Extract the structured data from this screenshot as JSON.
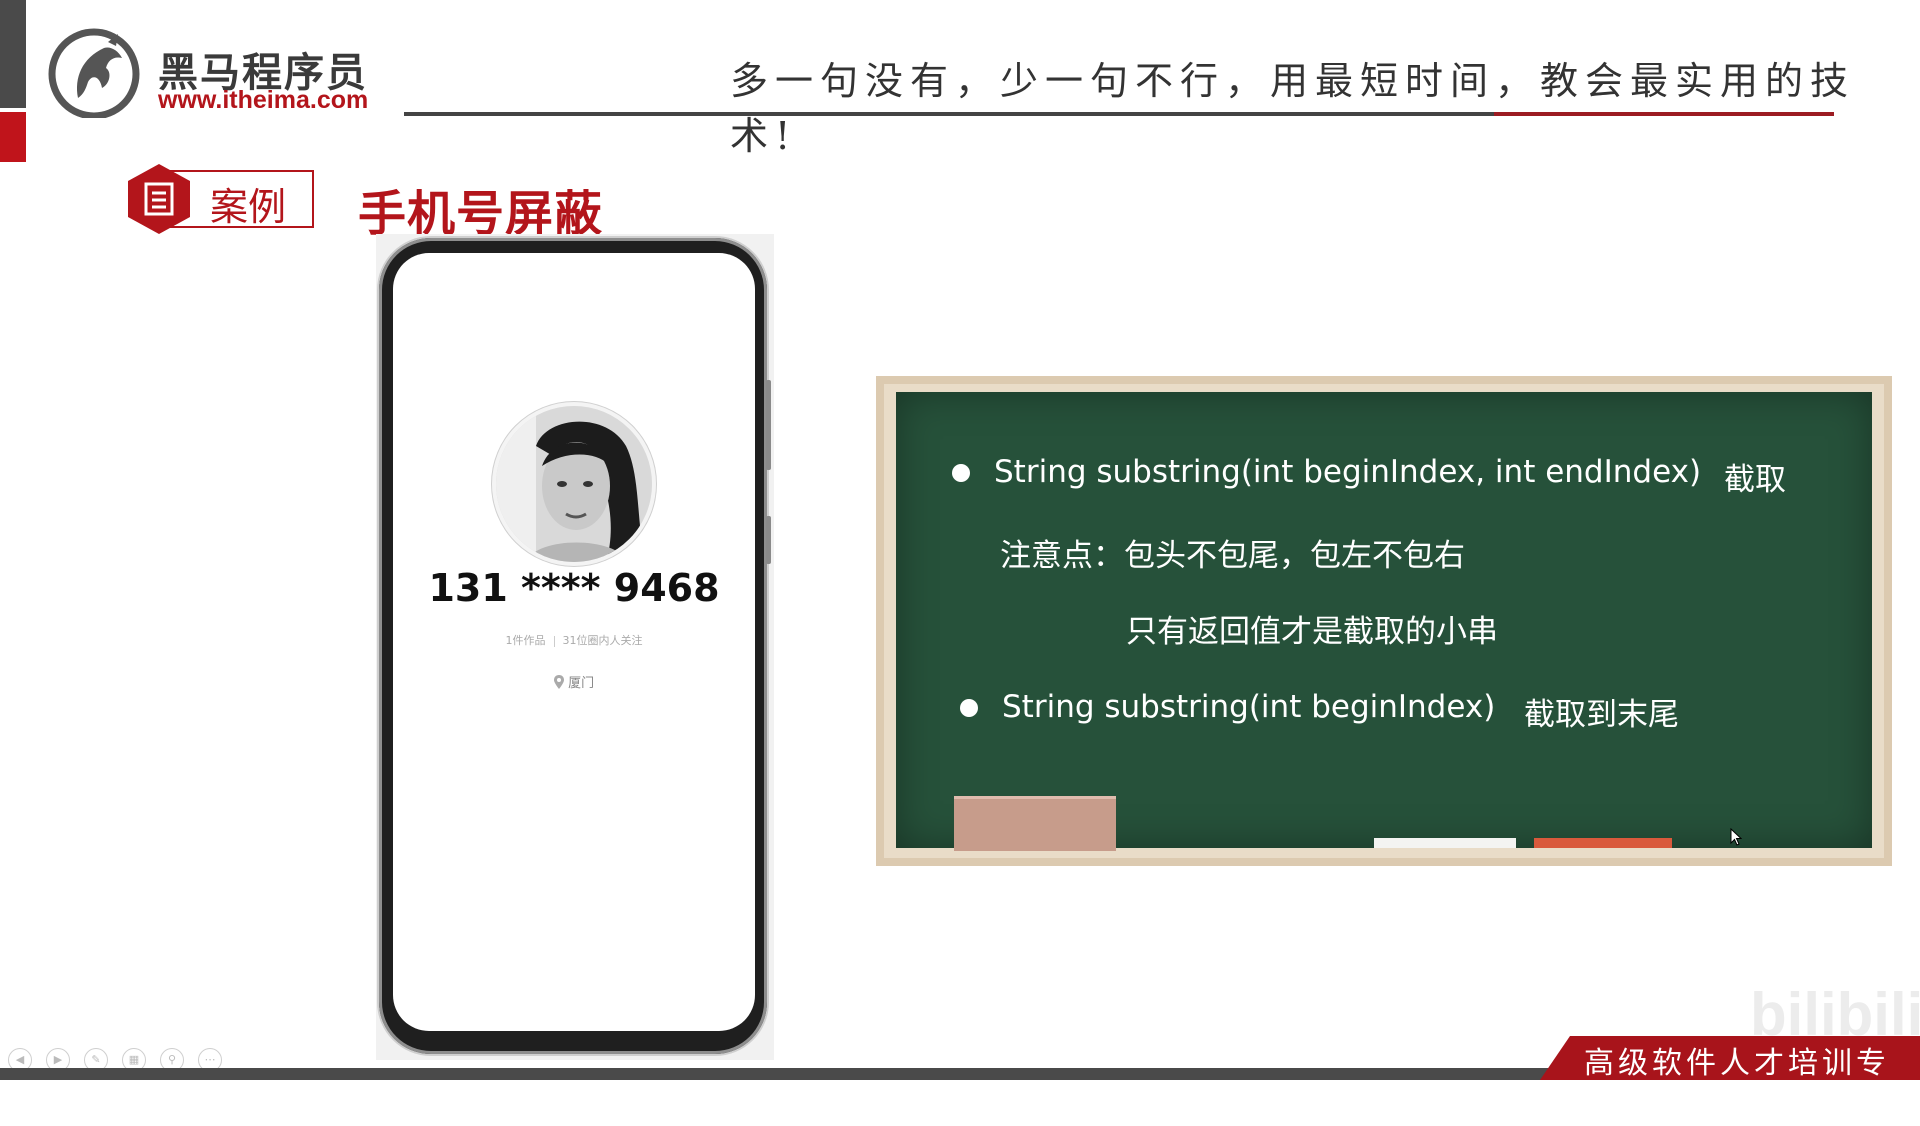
{
  "header": {
    "logo_name": "黑马程序员",
    "logo_url": "www.itheima.com",
    "slogan": "多一句没有，少一句不行，用最短时间，教会最实用的技术!"
  },
  "section": {
    "badge_label": "案例",
    "title": "手机号屏蔽"
  },
  "phone": {
    "number": "131 **** 9468",
    "stats_works": "1件作品",
    "stats_followers": "31位圈内人关注",
    "location": "厦门",
    "avatar_icon": "portrait-photo"
  },
  "board": {
    "line1_code": "String substring(int beginIndex, int endIndex)",
    "line1_desc": "截取",
    "line2": "注意点：包头不包尾，包左不包右",
    "line3": "只有返回值才是截取的小串",
    "line4_code": "String substring(int beginIndex)",
    "line4_desc": "截取到末尾"
  },
  "footer": {
    "banner": "高级软件人才培训专家",
    "watermark": "bilibili"
  },
  "colors": {
    "brand_red": "#b3151b",
    "board_green": "#26513a",
    "frame": "#dccab0"
  }
}
